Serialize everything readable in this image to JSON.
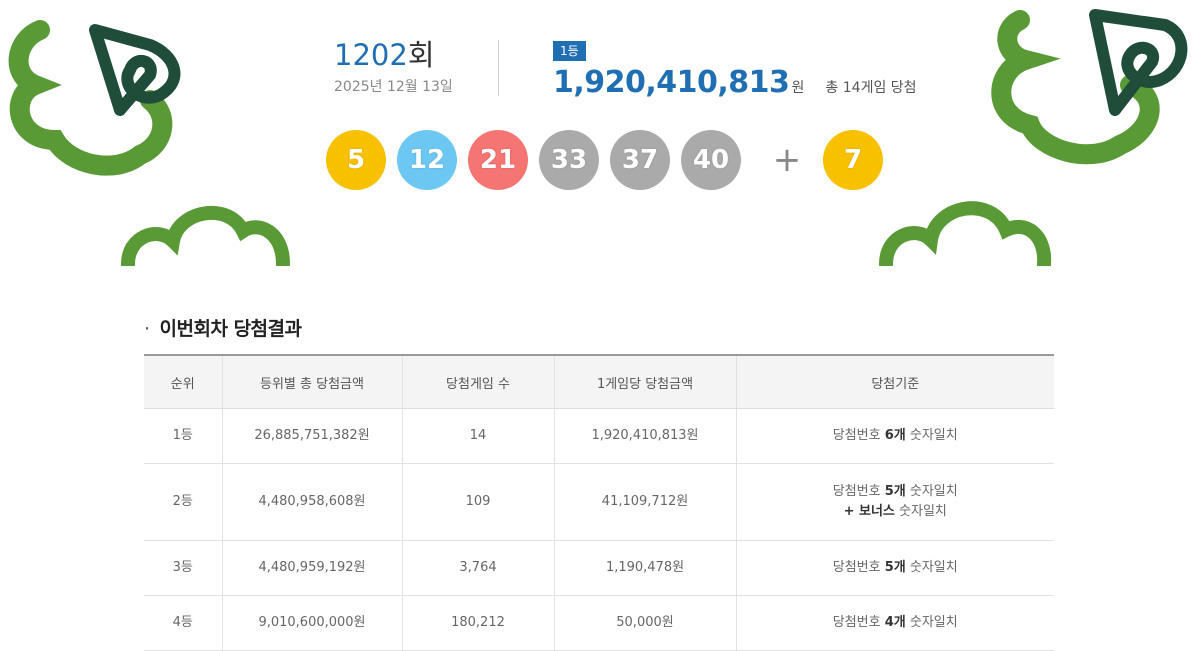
{
  "draw": {
    "number": "1202",
    "suffix": "회",
    "date": "2025년 12월 13일"
  },
  "first_prize": {
    "badge": "1등",
    "amount": "1,920,410,813",
    "unit": "원",
    "games_text": "총 14게임 당첨"
  },
  "balls": [
    {
      "number": "5",
      "color": "#f7c100"
    },
    {
      "number": "12",
      "color": "#6cc7f2"
    },
    {
      "number": "21",
      "color": "#f57573"
    },
    {
      "number": "33",
      "color": "#aaaaaa"
    },
    {
      "number": "37",
      "color": "#aaaaaa"
    },
    {
      "number": "40",
      "color": "#aaaaaa"
    }
  ],
  "plus_sign": "+",
  "bonus_ball": {
    "number": "7",
    "color": "#f7c100"
  },
  "section": {
    "bullet": "·",
    "title": "이번회차 당첨결과"
  },
  "table": {
    "headers": [
      "순위",
      "등위별 총 당첨금액",
      "당첨게임 수",
      "1게임당 당첨금액",
      "당첨기준"
    ],
    "rows": [
      {
        "rank": "1등",
        "total": "26,885,751,382원",
        "games": "14",
        "per_game": "1,920,410,813원",
        "crit_pre": "당첨번호 ",
        "crit_bold": "6개",
        "crit_post": " 숫자일치",
        "crit_line2": ""
      },
      {
        "rank": "2등",
        "total": "4,480,958,608원",
        "games": "109",
        "per_game": "41,109,712원",
        "crit_pre": "당첨번호 ",
        "crit_bold": "5개",
        "crit_post": " 숫자일치",
        "crit_line2_bold": "+ 보너스",
        "crit_line2_post": " 숫자일치"
      },
      {
        "rank": "3등",
        "total": "4,480,959,192원",
        "games": "3,764",
        "per_game": "1,190,478원",
        "crit_pre": "당첨번호 ",
        "crit_bold": "5개",
        "crit_post": " 숫자일치"
      },
      {
        "rank": "4등",
        "total": "9,010,600,000원",
        "games": "180,212",
        "per_game": "50,000원",
        "crit_pre": "당첨번호 ",
        "crit_bold": "4개",
        "crit_post": " 숫자일치"
      }
    ]
  },
  "colors": {
    "accent_blue": "#1f6fb2",
    "clover_light": "#5a9a36",
    "clover_dark": "#1f4d3a"
  }
}
